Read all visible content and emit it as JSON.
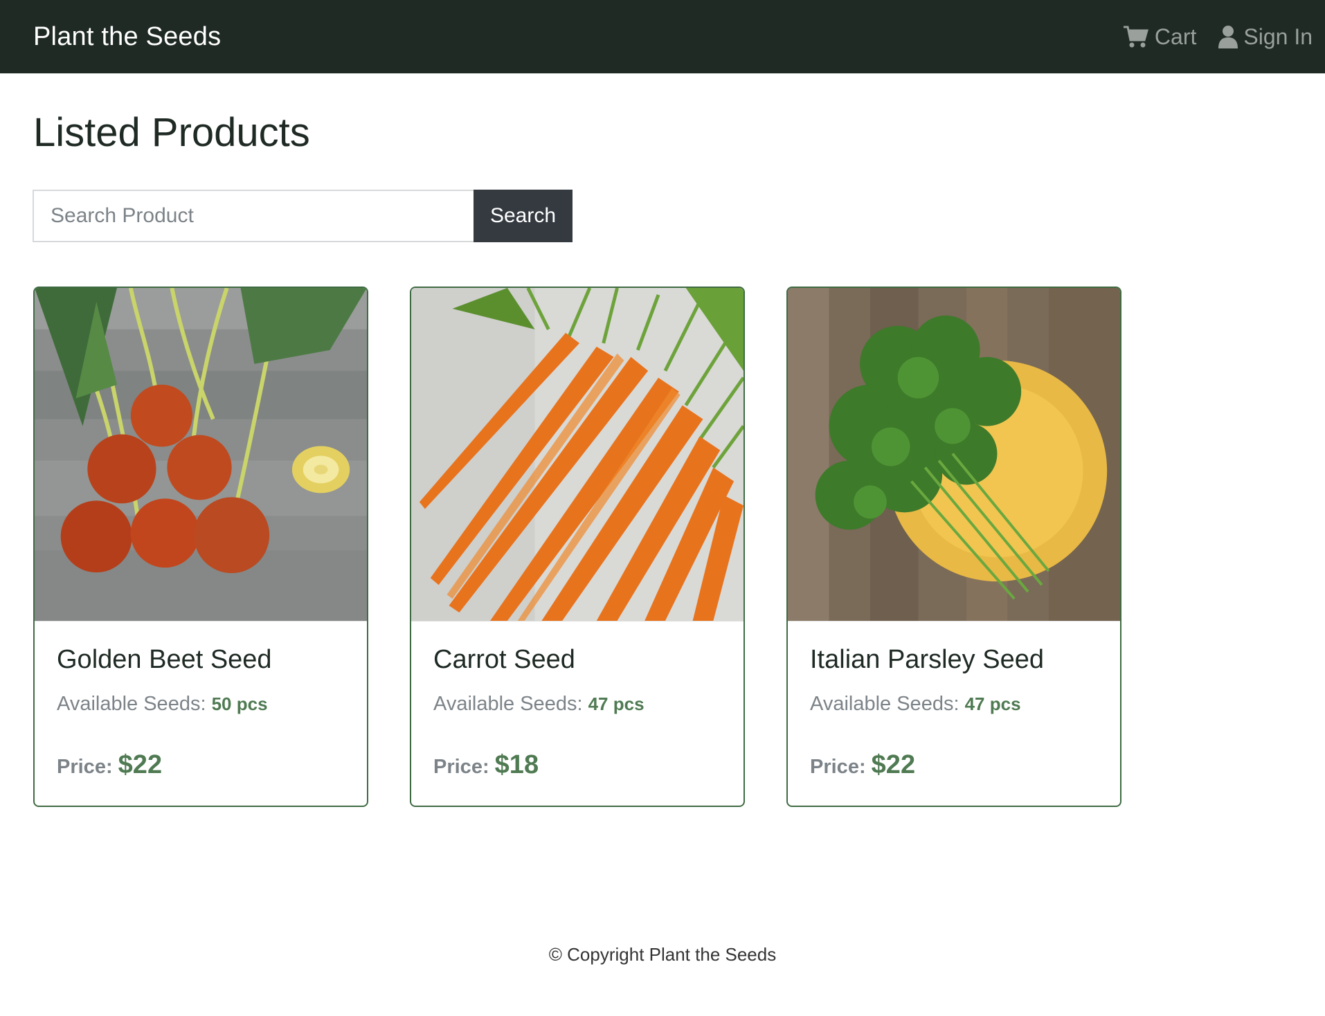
{
  "navbar": {
    "brand": "Plant the Seeds",
    "cart_label": "Cart",
    "signin_label": "Sign In",
    "icons": [
      "cart-icon",
      "user-icon"
    ]
  },
  "main": {
    "title": "Listed Products",
    "search": {
      "placeholder": "Search Product",
      "value": "",
      "button_label": "Search"
    },
    "products": [
      {
        "name": "Golden Beet Seed",
        "avail_label": "Available Seeds:",
        "qty": "50 pcs",
        "price_label": "Price:",
        "price": "$22"
      },
      {
        "name": "Carrot Seed",
        "avail_label": "Available Seeds:",
        "qty": "47 pcs",
        "price_label": "Price:",
        "price": "$18"
      },
      {
        "name": "Italian Parsley Seed",
        "avail_label": "Available Seeds:",
        "qty": "47 pcs",
        "price_label": "Price:",
        "price": "$22"
      }
    ]
  },
  "footer": {
    "text": "© Copyright Plant the Seeds"
  },
  "colors": {
    "navbar_bg": "#1f2a24",
    "accent_green": "#4f7a52",
    "card_border": "#3f6b43",
    "button_dark": "#343a40"
  }
}
